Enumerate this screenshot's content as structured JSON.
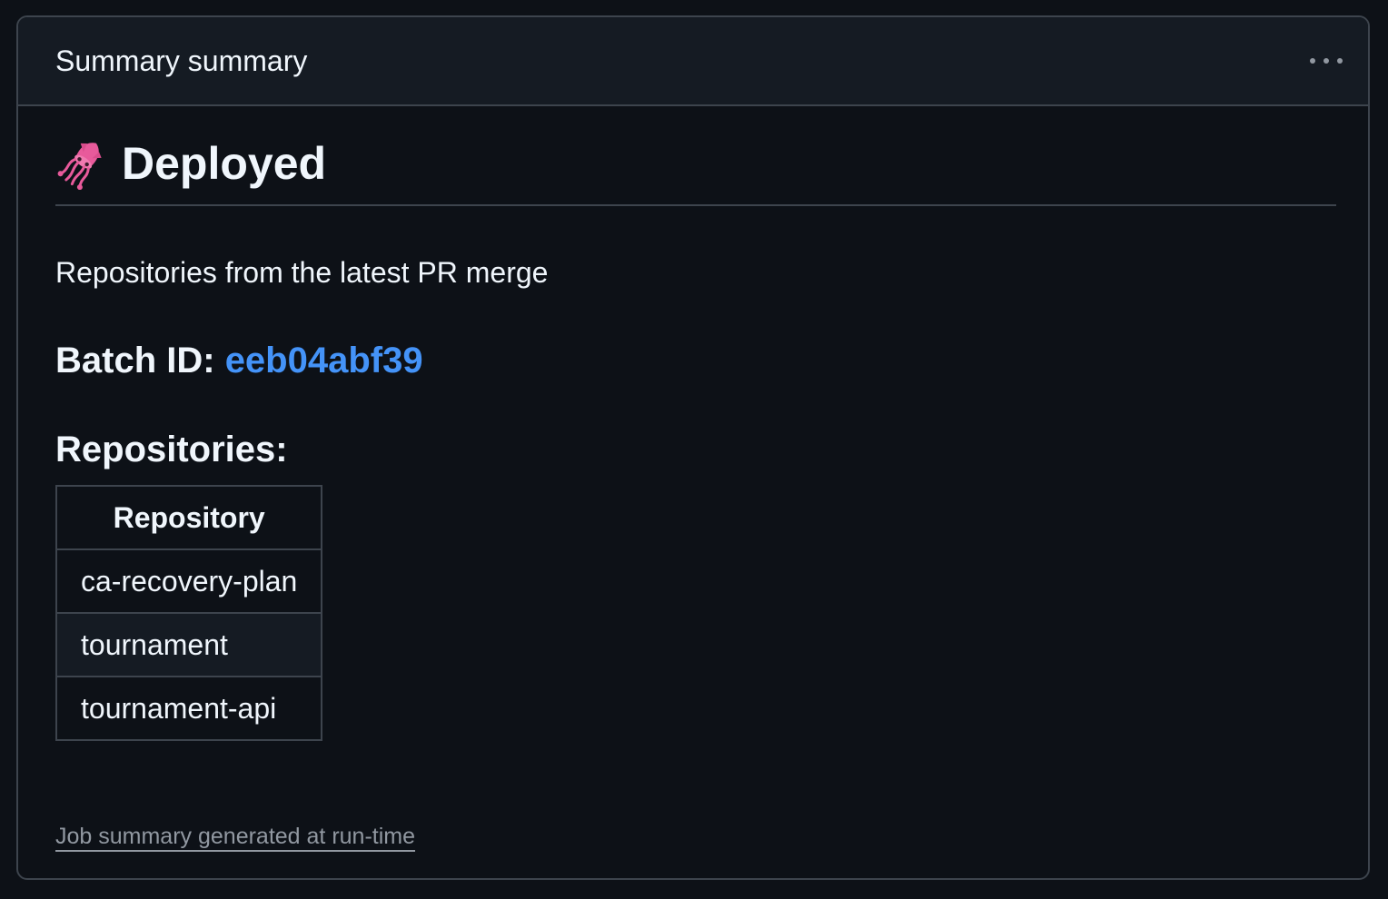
{
  "card": {
    "title": "Summary summary",
    "menu_icon": "kebab-horizontal-icon"
  },
  "content": {
    "heading_icon": "squid-emoji-icon",
    "heading": "Deployed",
    "description": "Repositories from the latest PR merge",
    "batch_label": "Batch ID: ",
    "batch_id": "eeb04abf39",
    "repositories_heading": "Repositories:",
    "table": {
      "header": "Repository",
      "rows": [
        "ca-recovery-plan",
        "tournament",
        "tournament-api"
      ]
    }
  },
  "footer": {
    "link_text": "Job summary generated at run-time"
  },
  "colors": {
    "background": "#0d1117",
    "header_bg": "#151b23",
    "border": "#3d444d",
    "link": "#4493f8",
    "muted": "#9198a1",
    "squid": "#e85a9b"
  }
}
